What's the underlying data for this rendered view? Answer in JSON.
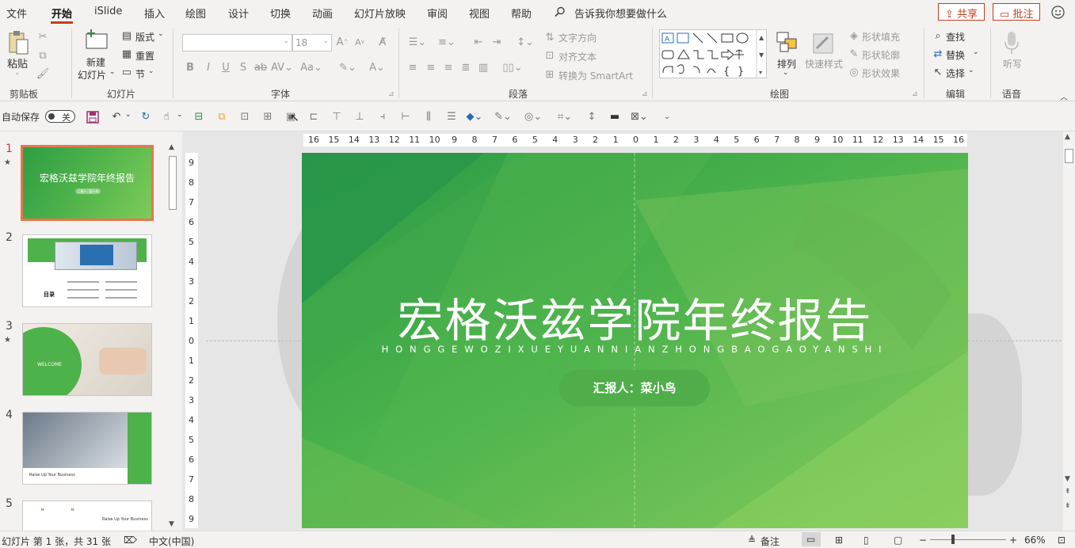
{
  "menu": {
    "tabs": [
      "文件",
      "开始",
      "iSlide",
      "插入",
      "绘图",
      "设计",
      "切换",
      "动画",
      "幻灯片放映",
      "审阅",
      "视图",
      "帮助"
    ],
    "active": "开始",
    "tell_me": "告诉我你想要做什么",
    "share": "共享",
    "comment": "批注"
  },
  "ribbon": {
    "clipboard": {
      "paste": "粘贴",
      "label": "剪贴板"
    },
    "slides": {
      "new_slide_1": "新建",
      "new_slide_2": "幻灯片",
      "layout": "版式",
      "reset": "重置",
      "section": "节",
      "label": "幻灯片"
    },
    "font": {
      "size": "18",
      "label": "字体"
    },
    "paragraph": {
      "text_direction": "文字方向",
      "align_text": "对齐文本",
      "smartart": "转换为 SmartArt",
      "label": "段落"
    },
    "drawing": {
      "arrange": "排列",
      "quick_styles": "快速样式",
      "shape_fill": "形状填充",
      "shape_outline": "形状轮廓",
      "shape_effects": "形状效果",
      "label": "绘图"
    },
    "editing": {
      "find": "查找",
      "replace": "替换",
      "select": "选择",
      "label": "编辑"
    },
    "voice": {
      "dictate": "听写",
      "label": "语音"
    }
  },
  "qat": {
    "autosave": "自动保存",
    "toggle": "关"
  },
  "thumbnails": [
    {
      "num": "1",
      "star": true,
      "title": "宏格沃兹学院年终报告",
      "sub": "汇报人: 菜小鸟"
    },
    {
      "num": "2",
      "star": false,
      "title": "目录"
    },
    {
      "num": "3",
      "star": true,
      "title": "WELCOME"
    },
    {
      "num": "4",
      "star": false,
      "title": "Raise Up Your Business"
    },
    {
      "num": "5",
      "star": false,
      "title": "Raise Up Your Business"
    }
  ],
  "slide": {
    "title": "宏格沃兹学院年终报告",
    "pinyin": "HONGGEWOZIXUEYUANNIANZHONGBAOGAOYANSHI",
    "presenter": "汇报人：菜小鸟"
  },
  "ruler": {
    "h": [
      "16",
      "15",
      "14",
      "13",
      "12",
      "11",
      "10",
      "9",
      "8",
      "7",
      "6",
      "5",
      "4",
      "3",
      "2",
      "1",
      "0",
      "1",
      "2",
      "3",
      "4",
      "5",
      "6",
      "7",
      "8",
      "9",
      "10",
      "11",
      "12",
      "13",
      "14",
      "15",
      "16"
    ],
    "v": [
      "9",
      "8",
      "7",
      "6",
      "5",
      "4",
      "3",
      "2",
      "1",
      "0",
      "1",
      "2",
      "3",
      "4",
      "5",
      "6",
      "7",
      "8",
      "9"
    ]
  },
  "status": {
    "slide_info": "幻灯片 第 1 张，共 31 张",
    "language": "中文(中国)",
    "notes": "备注",
    "zoom": "66%"
  },
  "colors": {
    "accent": "#c43e1c",
    "slide_green": "#5cb548",
    "thumb_selected": "#e8764b"
  }
}
